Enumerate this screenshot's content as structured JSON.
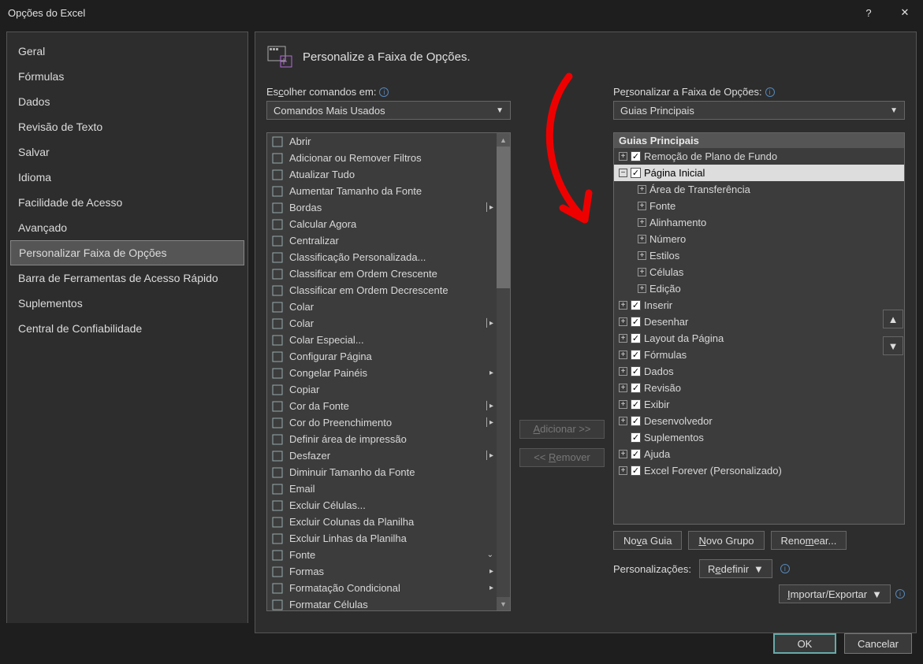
{
  "window": {
    "title": "Opções do Excel",
    "help": "?",
    "close": "✕"
  },
  "sidebar": {
    "items": [
      {
        "label": "Geral"
      },
      {
        "label": "Fórmulas"
      },
      {
        "label": "Dados"
      },
      {
        "label": "Revisão de Texto"
      },
      {
        "label": "Salvar"
      },
      {
        "label": "Idioma"
      },
      {
        "label": "Facilidade de Acesso"
      },
      {
        "label": "Avançado"
      },
      {
        "label": "Personalizar Faixa de Opções",
        "selected": true
      },
      {
        "label": "Barra de Ferramentas de Acesso Rápido"
      },
      {
        "label": "Suplementos"
      },
      {
        "label": "Central de Confiabilidade"
      }
    ]
  },
  "page": {
    "title": "Personalize a Faixa de Opções.",
    "choose_label": "Escolher comandos em:",
    "choose_value": "Comandos Mais Usados",
    "custom_label": "Personalizar a Faixa de Opções:",
    "custom_value": "Guias Principais"
  },
  "commands": [
    {
      "label": "Abrir"
    },
    {
      "label": "Adicionar ou Remover Filtros"
    },
    {
      "label": "Atualizar Tudo"
    },
    {
      "label": "Aumentar Tamanho da Fonte"
    },
    {
      "label": "Bordas",
      "split": true
    },
    {
      "label": "Calcular Agora"
    },
    {
      "label": "Centralizar"
    },
    {
      "label": "Classificação Personalizada..."
    },
    {
      "label": "Classificar em Ordem Crescente"
    },
    {
      "label": "Classificar em Ordem Decrescente"
    },
    {
      "label": "Colar"
    },
    {
      "label": "Colar",
      "split": true
    },
    {
      "label": "Colar Especial..."
    },
    {
      "label": "Configurar Página"
    },
    {
      "label": "Congelar Painéis",
      "menu": true
    },
    {
      "label": "Copiar"
    },
    {
      "label": "Cor da Fonte",
      "split": true
    },
    {
      "label": "Cor do Preenchimento",
      "split": true
    },
    {
      "label": "Definir área de impressão"
    },
    {
      "label": "Desfazer",
      "split": true
    },
    {
      "label": "Diminuir Tamanho da Fonte"
    },
    {
      "label": "Email"
    },
    {
      "label": "Excluir Células..."
    },
    {
      "label": "Excluir Colunas da Planilha"
    },
    {
      "label": "Excluir Linhas da Planilha"
    },
    {
      "label": "Fonte",
      "gallery": true
    },
    {
      "label": "Formas",
      "menu": true
    },
    {
      "label": "Formatação Condicional",
      "menu": true
    },
    {
      "label": "Formatar Células"
    }
  ],
  "transfer": {
    "add": "Adicionar >>",
    "remove": "<< Remover"
  },
  "tree": {
    "header": "Guias Principais",
    "items": [
      {
        "level": 0,
        "exp": "+",
        "chk": true,
        "label": "Remoção de Plano de Fundo"
      },
      {
        "level": 0,
        "exp": "-",
        "chk": true,
        "label": "Página Inicial",
        "selected": true
      },
      {
        "level": 1,
        "exp": "+",
        "label": "Área de Transferência"
      },
      {
        "level": 1,
        "exp": "+",
        "label": "Fonte"
      },
      {
        "level": 1,
        "exp": "+",
        "label": "Alinhamento"
      },
      {
        "level": 1,
        "exp": "+",
        "label": "Número"
      },
      {
        "level": 1,
        "exp": "+",
        "label": "Estilos"
      },
      {
        "level": 1,
        "exp": "+",
        "label": "Células"
      },
      {
        "level": 1,
        "exp": "+",
        "label": "Edição"
      },
      {
        "level": 0,
        "exp": "+",
        "chk": true,
        "label": "Inserir"
      },
      {
        "level": 0,
        "exp": "+",
        "chk": true,
        "label": "Desenhar"
      },
      {
        "level": 0,
        "exp": "+",
        "chk": true,
        "label": "Layout da Página"
      },
      {
        "level": 0,
        "exp": "+",
        "chk": true,
        "label": "Fórmulas"
      },
      {
        "level": 0,
        "exp": "+",
        "chk": true,
        "label": "Dados"
      },
      {
        "level": 0,
        "exp": "+",
        "chk": true,
        "label": "Revisão"
      },
      {
        "level": 0,
        "exp": "+",
        "chk": true,
        "label": "Exibir"
      },
      {
        "level": 0,
        "exp": "+",
        "chk": true,
        "label": "Desenvolvedor"
      },
      {
        "level": 0,
        "exp": "",
        "chk": true,
        "label": "Suplementos",
        "noexp": true
      },
      {
        "level": 0,
        "exp": "+",
        "chk": true,
        "label": "Ajuda"
      },
      {
        "level": 0,
        "exp": "+",
        "chk": true,
        "label": "Excel Forever (Personalizado)"
      }
    ]
  },
  "actions": {
    "new_tab": "Nova Guia",
    "new_group": "Novo Grupo",
    "rename": "Renomear...",
    "custom_label": "Personalizações:",
    "reset": "Redefinir",
    "impexp": "Importar/Exportar"
  },
  "footer": {
    "ok": "OK",
    "cancel": "Cancelar"
  }
}
